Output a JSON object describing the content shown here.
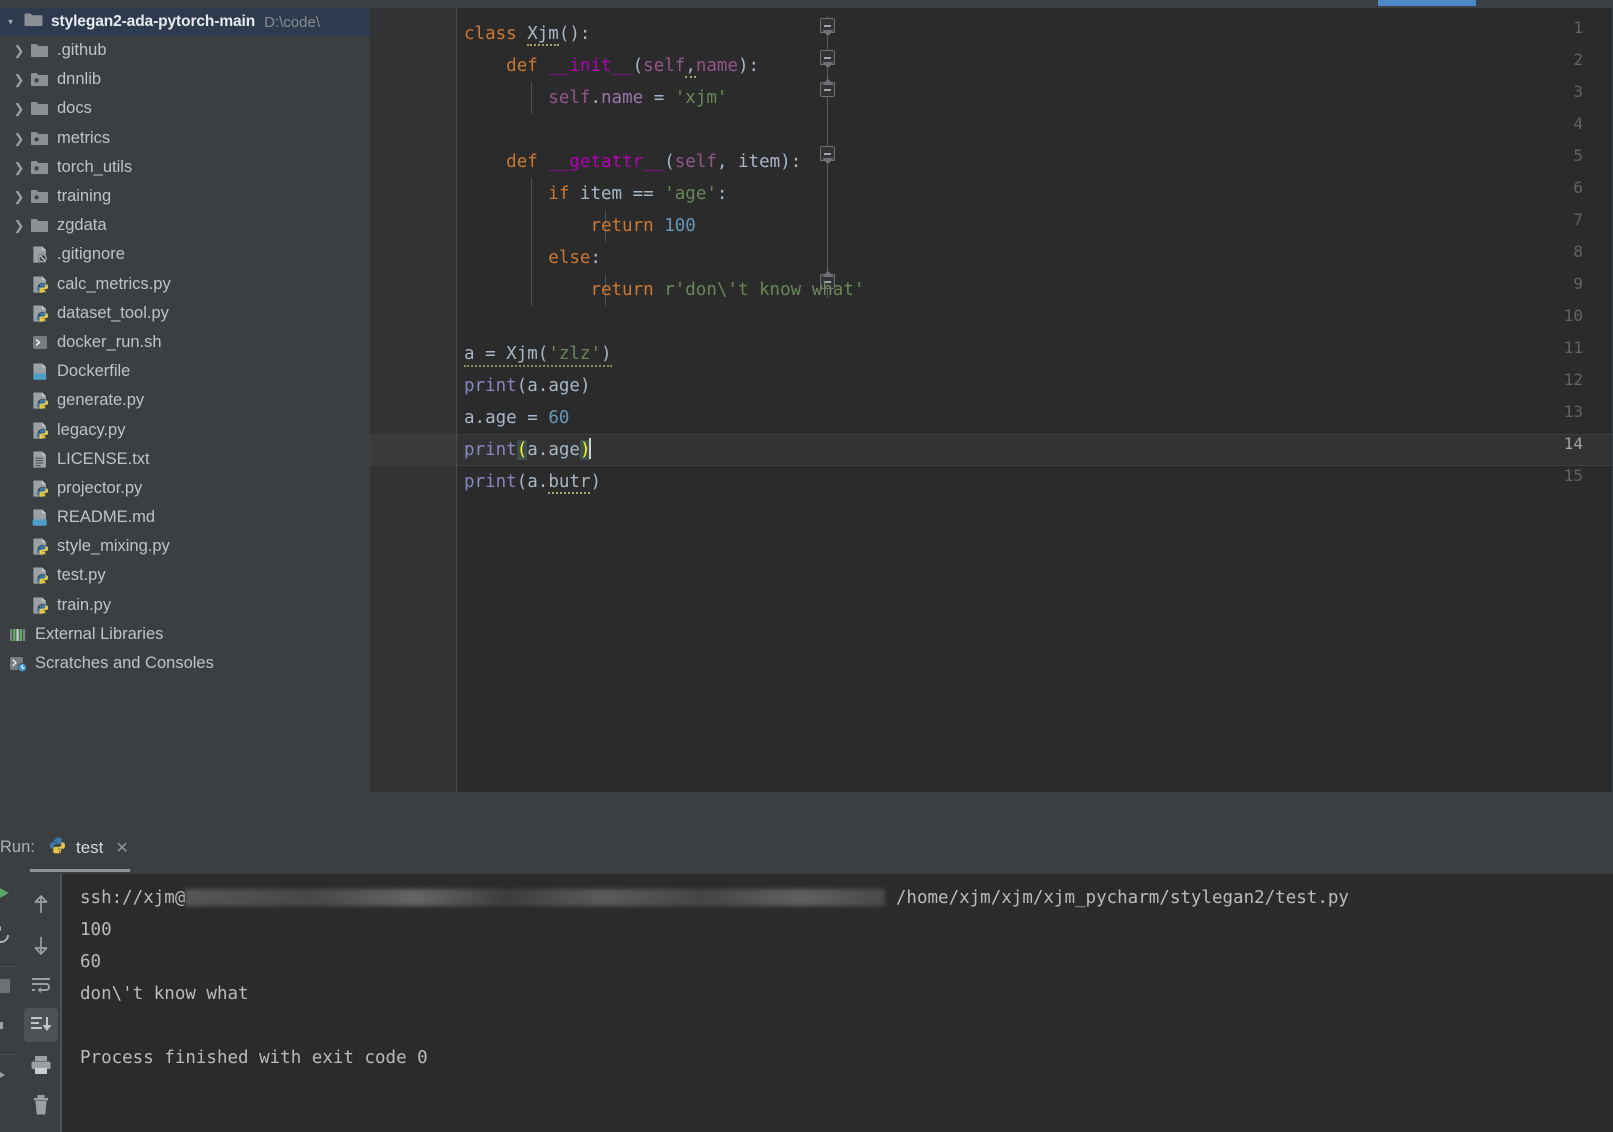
{
  "window": {
    "theme_bg": "#3c3f41",
    "editor_bg": "#2b2b2b",
    "accent_blue": "#4a88c7"
  },
  "project_tree": {
    "root": {
      "name": "stylegan2-ada-pytorch-main",
      "path": "D:\\code\\",
      "icon": "folder-icon",
      "selected": true
    },
    "items": [
      {
        "label": ".github",
        "icon": "folder-icon",
        "expandable": true,
        "depth": 1
      },
      {
        "label": "dnnlib",
        "icon": "folder-python-icon",
        "expandable": true,
        "depth": 1
      },
      {
        "label": "docs",
        "icon": "folder-icon",
        "expandable": true,
        "depth": 1
      },
      {
        "label": "metrics",
        "icon": "folder-python-icon",
        "expandable": true,
        "depth": 1
      },
      {
        "label": "torch_utils",
        "icon": "folder-python-icon",
        "expandable": true,
        "depth": 1
      },
      {
        "label": "training",
        "icon": "folder-python-icon",
        "expandable": true,
        "depth": 1
      },
      {
        "label": "zgdata",
        "icon": "folder-icon",
        "expandable": true,
        "depth": 1
      },
      {
        "label": ".gitignore",
        "icon": "gitignore-file-icon",
        "expandable": false,
        "depth": 1
      },
      {
        "label": "calc_metrics.py",
        "icon": "python-file-icon",
        "expandable": false,
        "depth": 1
      },
      {
        "label": "dataset_tool.py",
        "icon": "python-file-icon",
        "expandable": false,
        "depth": 1
      },
      {
        "label": "docker_run.sh",
        "icon": "shell-file-icon",
        "expandable": false,
        "depth": 1
      },
      {
        "label": "Dockerfile",
        "icon": "dockerfile-icon",
        "expandable": false,
        "depth": 1
      },
      {
        "label": "generate.py",
        "icon": "python-file-icon",
        "expandable": false,
        "depth": 1
      },
      {
        "label": "legacy.py",
        "icon": "python-file-icon",
        "expandable": false,
        "depth": 1
      },
      {
        "label": "LICENSE.txt",
        "icon": "text-file-icon",
        "expandable": false,
        "depth": 1
      },
      {
        "label": "projector.py",
        "icon": "python-file-icon",
        "expandable": false,
        "depth": 1
      },
      {
        "label": "README.md",
        "icon": "markdown-file-icon",
        "expandable": false,
        "depth": 1
      },
      {
        "label": "style_mixing.py",
        "icon": "python-file-icon",
        "expandable": false,
        "depth": 1
      },
      {
        "label": "test.py",
        "icon": "python-file-icon",
        "expandable": false,
        "depth": 1
      },
      {
        "label": "train.py",
        "icon": "python-file-icon",
        "expandable": false,
        "depth": 1
      },
      {
        "label": "External Libraries",
        "icon": "external-libraries-icon",
        "expandable": false,
        "depth": 0
      },
      {
        "label": "Scratches and Consoles",
        "icon": "scratches-icon",
        "expandable": false,
        "depth": 0
      }
    ]
  },
  "editor": {
    "line_numbers": [
      "1",
      "2",
      "3",
      "4",
      "5",
      "6",
      "7",
      "8",
      "9",
      "10",
      "11",
      "12",
      "13",
      "14",
      "15"
    ],
    "current_line": 14,
    "lines": [
      "class Xjm():",
      "    def __init__(self,name):",
      "        self.name = 'xjm'",
      "",
      "    def __getattr__(self, item):",
      "        if item == 'age':",
      "            return 100",
      "        else:",
      "            return r'don\\'t know what'",
      "",
      "a = Xjm('zlz')",
      "print(a.age)",
      "a.age = 60",
      "print(a.age)",
      "print(a.butr)"
    ]
  },
  "run_panel": {
    "label": "Run:",
    "tab": {
      "name": "test",
      "icon": "python-file-icon",
      "close_icon": "close-icon"
    },
    "toolbar": [
      {
        "name": "run-icon",
        "active": false
      },
      {
        "name": "rerun-icon",
        "active": false
      },
      {
        "name": "stop-icon",
        "active": false
      },
      {
        "name": "up-arrow-icon",
        "active": false
      },
      {
        "name": "down-arrow-icon",
        "active": false
      },
      {
        "name": "soft-wrap-icon",
        "active": false
      },
      {
        "name": "scroll-to-end-icon",
        "active": true
      },
      {
        "name": "print-icon",
        "active": false
      },
      {
        "name": "trash-icon",
        "active": false
      }
    ],
    "console_lines": [
      {
        "prefix": "ssh://xjm@",
        "redacted": true,
        "suffix": " /home/xjm/xjm/xjm_pycharm/stylegan2/test.py"
      },
      {
        "prefix": "100",
        "redacted": false,
        "suffix": ""
      },
      {
        "prefix": "60",
        "redacted": false,
        "suffix": ""
      },
      {
        "prefix": "don\\'t know what",
        "redacted": false,
        "suffix": ""
      },
      {
        "prefix": "",
        "redacted": false,
        "suffix": ""
      },
      {
        "prefix": "Process finished with exit code 0",
        "redacted": false,
        "suffix": ""
      }
    ]
  }
}
